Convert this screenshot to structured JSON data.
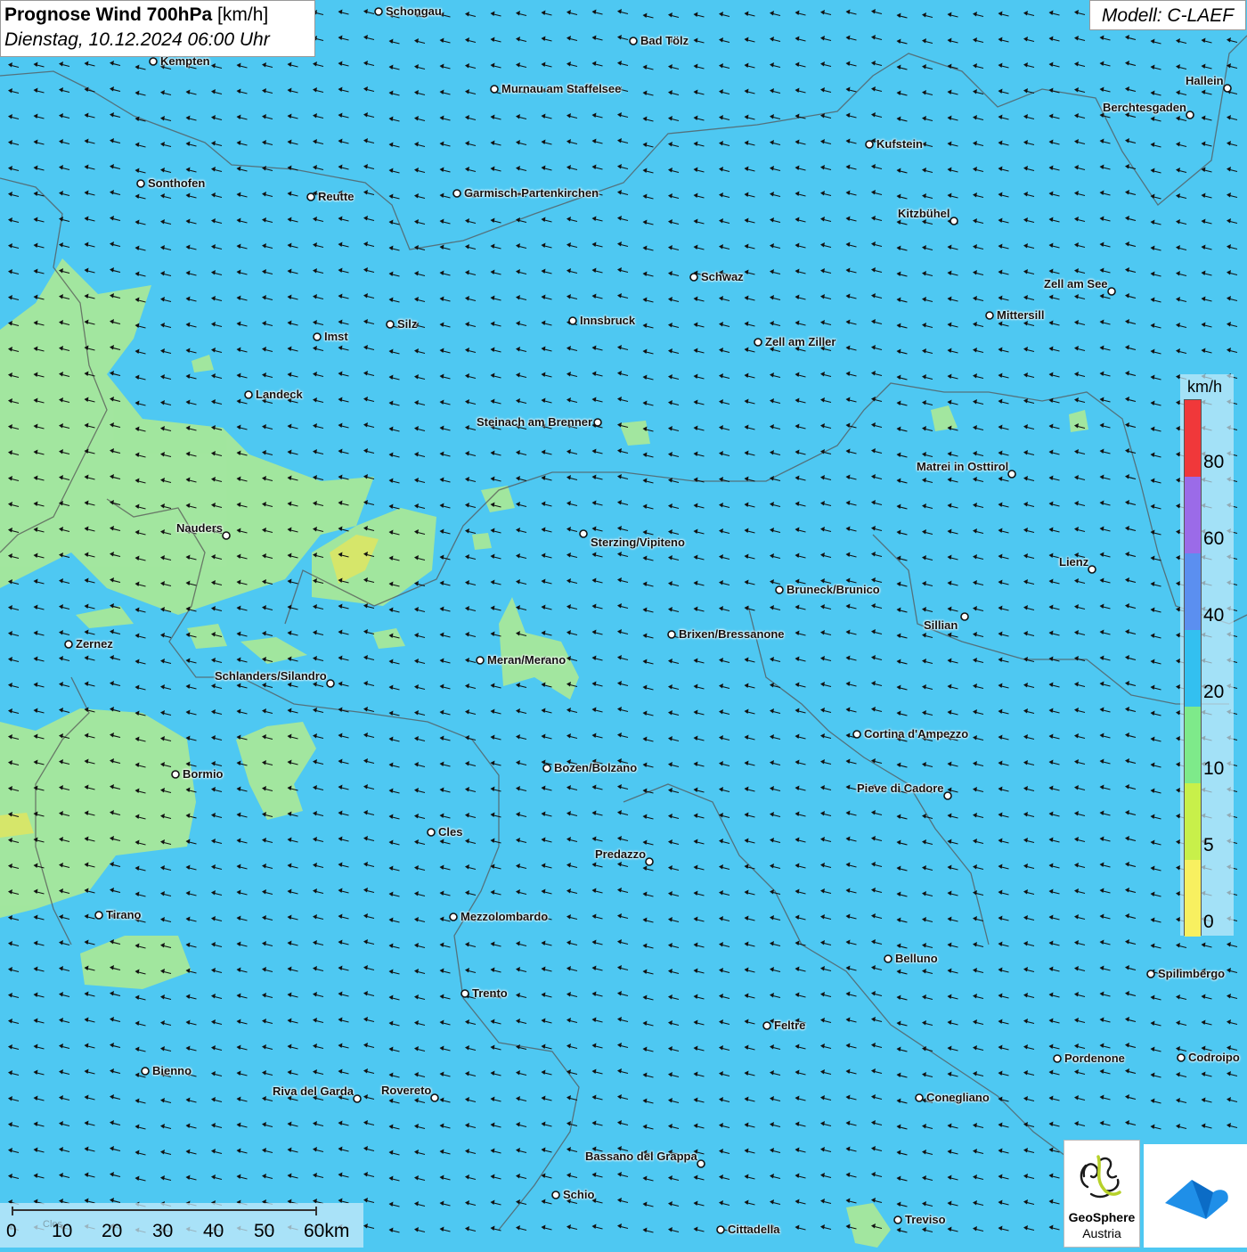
{
  "title": {
    "main": "Prognose Wind 700hPa",
    "unit": "[km/h]",
    "datetime": "Dienstag, 10.12.2024 06:00 Uhr"
  },
  "model": "Modell: C-LAEF",
  "legend": {
    "unit": "km/h",
    "ticks": [
      "80",
      "60",
      "40",
      "20",
      "10",
      "5",
      "0"
    ],
    "colors": [
      "#f0383a",
      "#9b6be8",
      "#5b8ff0",
      "#33c0f0",
      "#7eea8a",
      "#c8f04a",
      "#f8f060"
    ]
  },
  "scale_bar": {
    "labels": [
      "0",
      "10",
      "20",
      "30",
      "40",
      "50",
      "60km"
    ],
    "faint_label": "Cles"
  },
  "cities": [
    "Schongau",
    "Bad Tölz",
    "Kempten",
    "Murnau am Staffelsee",
    "Hallein",
    "Berchtesgaden",
    "Kufstein",
    "Sonthofen",
    "Reutte",
    "Garmisch-Partenkirchen",
    "Kitzbühel",
    "Schwaz",
    "Zell am See",
    "Mittersill",
    "Innsbruck",
    "Silz",
    "Imst",
    "Zell am Ziller",
    "Landeck",
    "Steinach am Brenner",
    "Matrei in Osttirol",
    "Nauders",
    "Sterzing/Vipiteno",
    "Lienz",
    "Bruneck/Brunico",
    "Sillian",
    "Zernez",
    "Brixen/Bressanone",
    "Meran/Merano",
    "Schlanders/Silandro",
    "Cortina d'Ampezzo",
    "Bozen/Bolzano",
    "Bormio",
    "Pieve di Cadore",
    "Cles",
    "Predazzo",
    "Tirano",
    "Mezzolombardo",
    "Belluno",
    "Spilimbergo",
    "Trento",
    "Feltre",
    "Pordenone",
    "Codroipo",
    "Bienno",
    "Riva del Garda",
    "Rovereto",
    "Conegliano",
    "Bassano del Grappa",
    "Schio",
    "Treviso",
    "Cittadella"
  ],
  "logos": {
    "geosphere_line1": "GeoSphere",
    "geosphere_line2": "Austria"
  },
  "colors": {
    "background": "#4ec8f2",
    "low_wind": "#a6e89a",
    "mid_wind": "#d6e66a",
    "arrow": "#111111"
  }
}
